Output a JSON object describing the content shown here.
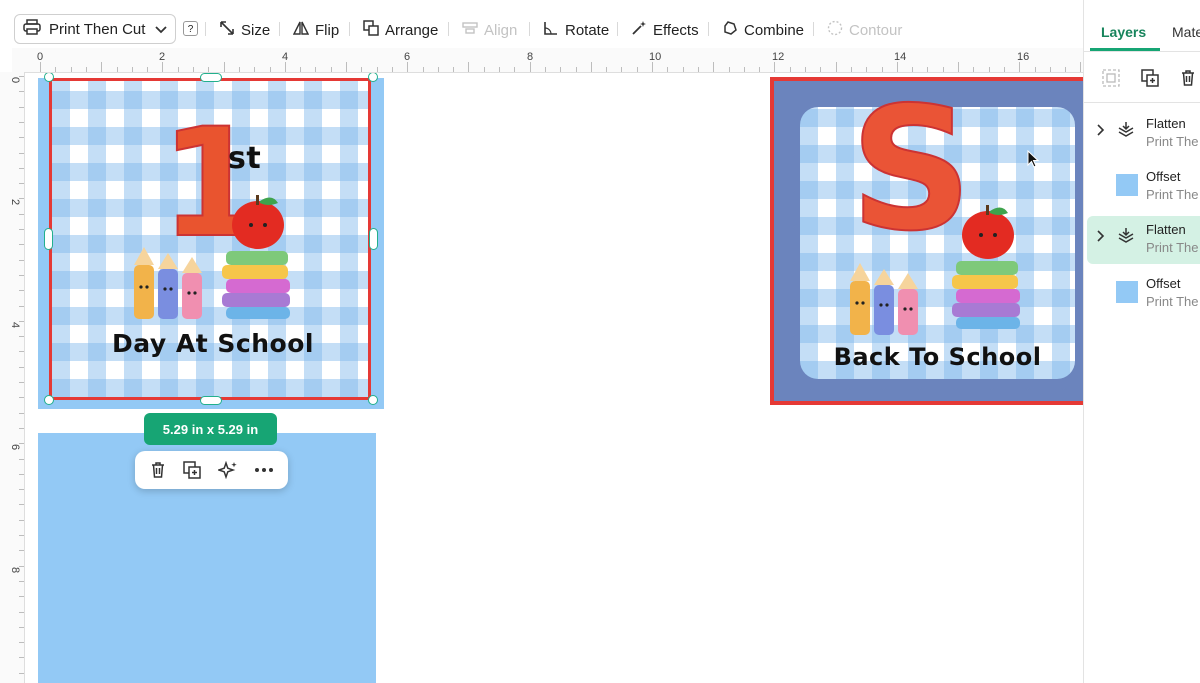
{
  "toolbar": {
    "operation": "Print Then Cut",
    "help": "?",
    "size": "Size",
    "flip": "Flip",
    "arrange": "Arrange",
    "align": "Align",
    "rotate": "Rotate",
    "effects": "Effects",
    "combine": "Combine",
    "contour": "Contour"
  },
  "ruler": {
    "top": [
      "0",
      "2",
      "4",
      "6",
      "8",
      "10",
      "12",
      "14",
      "16"
    ],
    "left": [
      "0",
      "2",
      "4",
      "6",
      "8"
    ]
  },
  "designs": {
    "first": {
      "big_letter": "1",
      "superscript": "st",
      "caption": "Day At School"
    },
    "second": {
      "big_letter": "S",
      "caption": "Back To School"
    }
  },
  "selection": {
    "size": "5.29  in x 5.29  in"
  },
  "panel": {
    "tabs": [
      "Layers",
      "Mate"
    ],
    "layers": [
      {
        "title": "Flatten",
        "subtitle": "Print The",
        "type": "group",
        "selected": false
      },
      {
        "title": "Offset",
        "subtitle": "Print The",
        "type": "shape",
        "selected": false
      },
      {
        "title": "Flatten",
        "subtitle": "Print The",
        "type": "group",
        "selected": true
      },
      {
        "title": "Offset",
        "subtitle": "Print The",
        "type": "shape",
        "selected": false
      }
    ]
  },
  "colors": {
    "accent_green": "#17a574",
    "selected_layer": "#d4f1e4",
    "offset_blue": "#93c9f5",
    "red_border": "#e53935",
    "scallop": "#6b84bd"
  },
  "icons": [
    "printer-icon",
    "help-icon",
    "size-icon",
    "flip-icon",
    "arrange-icon",
    "align-icon",
    "rotate-icon",
    "effects-icon",
    "combine-icon",
    "contour-icon",
    "trash-icon",
    "duplicate-icon",
    "sparkle-icon",
    "more-icon",
    "group-icon",
    "chevron-right-icon",
    "cursor-icon"
  ]
}
